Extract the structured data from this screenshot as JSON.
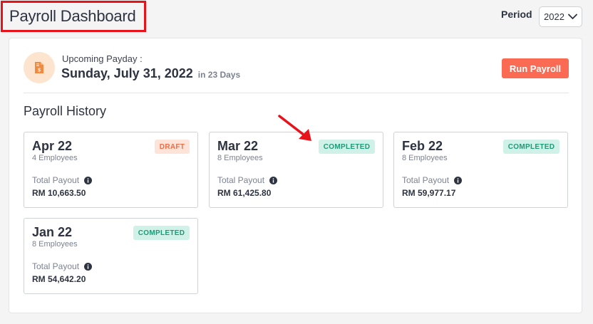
{
  "header": {
    "title": "Payroll Dashboard",
    "period_label": "Period",
    "period_value": "2022"
  },
  "payday": {
    "label": "Upcoming Payday :",
    "date": "Sunday, July 31, 2022",
    "days": "in 23 Days",
    "icon": "payslip-icon"
  },
  "actions": {
    "run_payroll": "Run Payroll"
  },
  "history": {
    "title": "Payroll History",
    "runs": [
      {
        "month": "Apr 22",
        "employees": "4 Employees",
        "status": "DRAFT",
        "payout_label": "Total Payout",
        "payout": "RM 10,663.50"
      },
      {
        "month": "Mar 22",
        "employees": "8 Employees",
        "status": "COMPLETED",
        "payout_label": "Total Payout",
        "payout": "RM 61,425.80"
      },
      {
        "month": "Feb 22",
        "employees": "8 Employees",
        "status": "COMPLETED",
        "payout_label": "Total Payout",
        "payout": "RM 59,977.17"
      },
      {
        "month": "Jan 22",
        "employees": "8 Employees",
        "status": "COMPLETED",
        "payout_label": "Total Payout",
        "payout": "RM 54,642.20"
      }
    ]
  },
  "colors": {
    "accent": "#fb6b53",
    "draft_bg": "#fde3d8",
    "draft_text": "#f26e46",
    "completed_bg": "#cff1e8",
    "completed_text": "#1f9a78",
    "highlight": "#e8131a"
  }
}
